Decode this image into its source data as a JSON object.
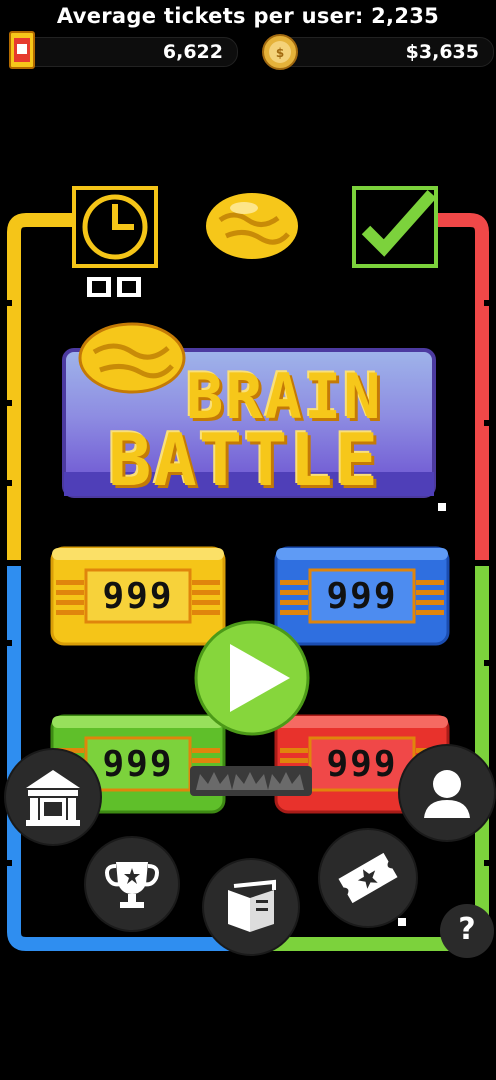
{
  "header": {
    "average_label": "Average tickets per user: 2,235",
    "tickets_value": "6,622",
    "money_value": "$3,635",
    "ticket_icon": "ticket-icon",
    "coin_icon": "brain-coin-icon"
  },
  "top_row": {
    "timer_digits": "00",
    "clock_icon": "clock-icon",
    "brain_icon": "brain-icon",
    "check_icon": "checkmark-icon"
  },
  "logo": {
    "line1": "BRAIN",
    "line2": "BATTLE"
  },
  "pads": [
    {
      "color": "yellow",
      "value": "999"
    },
    {
      "color": "blue",
      "value": "999"
    },
    {
      "color": "green",
      "value": "999"
    },
    {
      "color": "red",
      "value": "999"
    }
  ],
  "buttons": {
    "play": "play-icon",
    "museum": "museum-icon",
    "trophy": "trophy-icon",
    "book": "book-icon",
    "ticket_star": "ticket-star-icon",
    "profile": "profile-icon",
    "help_label": "?"
  },
  "colors": {
    "yellow": "#f5c518",
    "red": "#f04848",
    "blue": "#2f8ef0",
    "green": "#7cd23c",
    "gold": "#f6c71a"
  }
}
